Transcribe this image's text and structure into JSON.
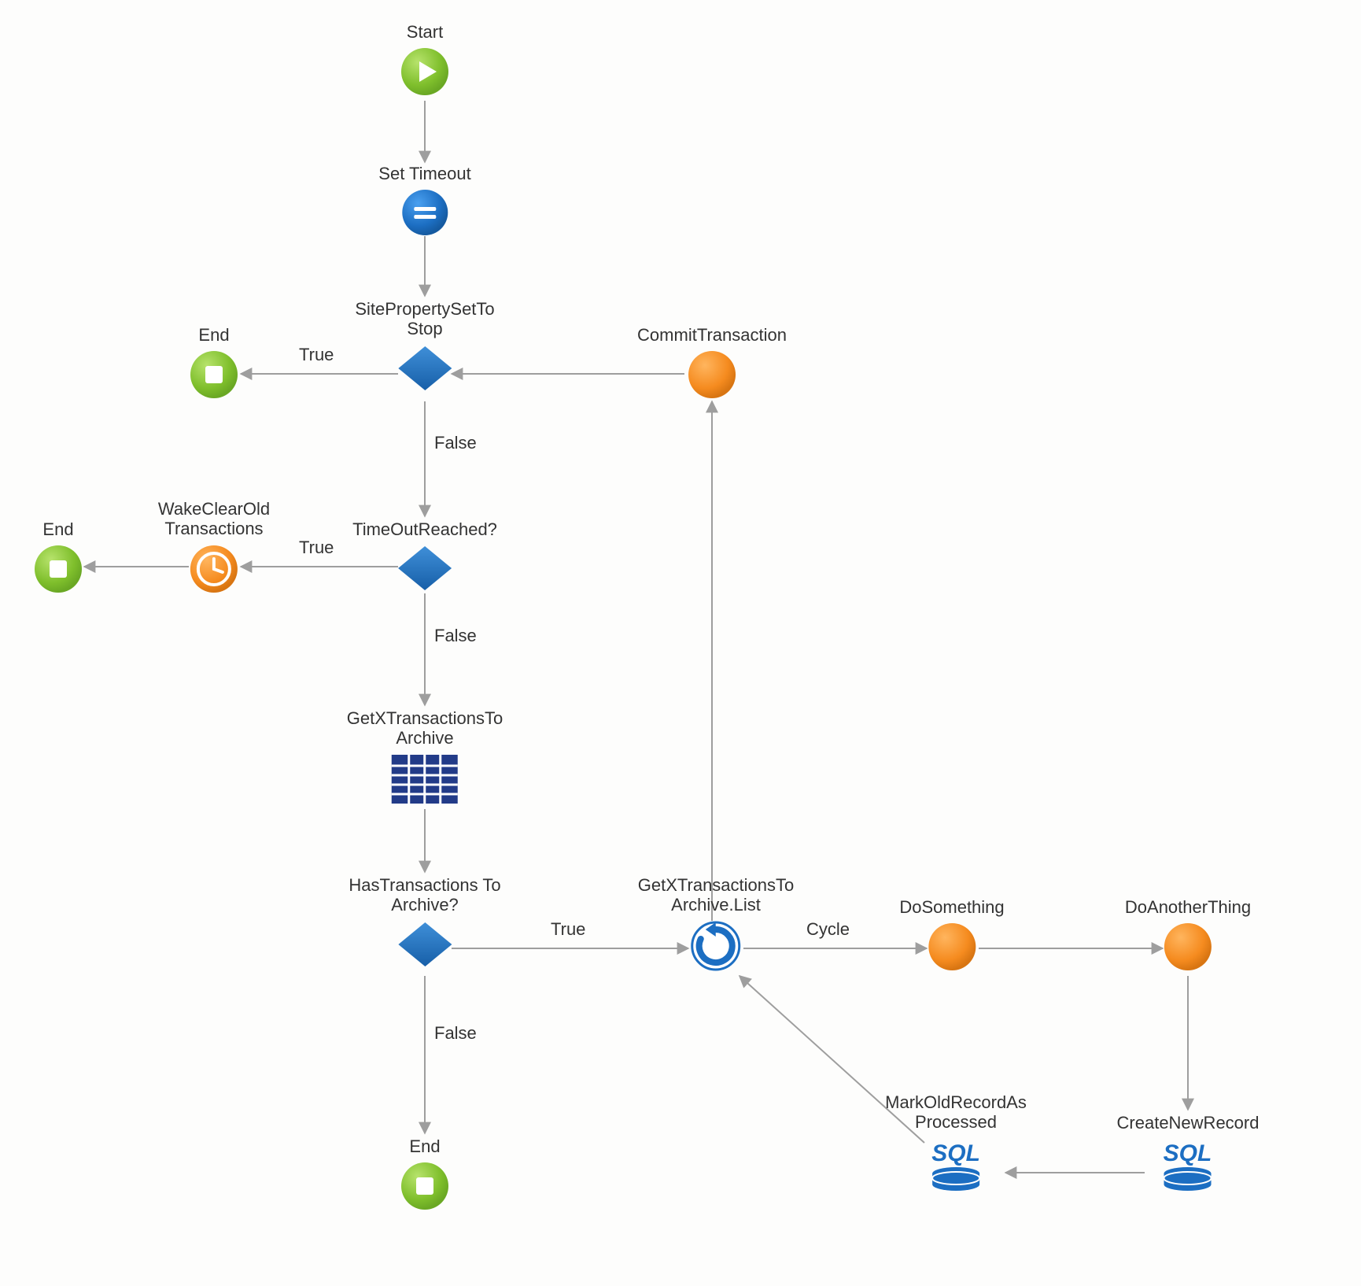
{
  "nodes": {
    "start": {
      "label": "Start"
    },
    "setTimeout": {
      "label": "Set Timeout"
    },
    "siteProp": {
      "label": "SitePropertySetTo\nStop"
    },
    "end1": {
      "label": "End"
    },
    "commit": {
      "label": "CommitTransaction"
    },
    "timeout": {
      "label": "TimeOutReached?"
    },
    "wake": {
      "label": "WakeClearOld\nTransactions"
    },
    "end2": {
      "label": "End"
    },
    "getX": {
      "label": "GetXTransactionsTo\nArchive"
    },
    "hasTx": {
      "label": "HasTransactions To\nArchive?"
    },
    "list": {
      "label": "GetXTransactionsTo\nArchive.List"
    },
    "doSomething": {
      "label": "DoSomething"
    },
    "doAnother": {
      "label": "DoAnotherThing"
    },
    "createNew": {
      "label": "CreateNewRecord"
    },
    "markOld": {
      "label": "MarkOldRecordAs\nProcessed"
    },
    "end3": {
      "label": "End"
    }
  },
  "edgeLabels": {
    "true1": "True",
    "false1": "False",
    "true2": "True",
    "false2": "False",
    "true3": "True",
    "false3": "False",
    "cycle": "Cycle"
  },
  "colors": {
    "green": "#7fbf2c",
    "blue": "#1c6ec2",
    "orange": "#f58b1f",
    "arrow": "#9e9e9e",
    "navy": "#223b88"
  }
}
